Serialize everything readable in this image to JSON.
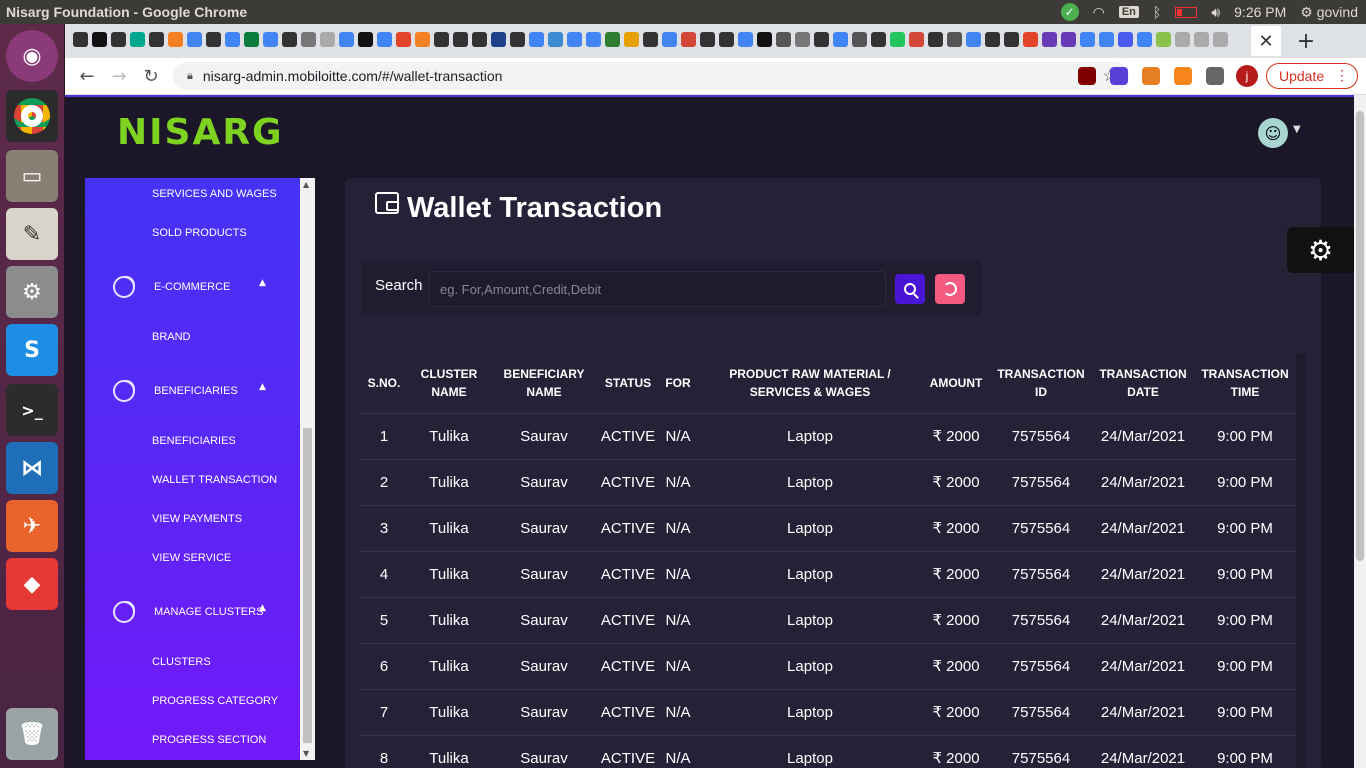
{
  "os": {
    "window_title": "Nisarg Foundation - Google Chrome",
    "lang": "En",
    "time": "9:26 PM",
    "user": "govind"
  },
  "browser": {
    "url": "nisarg-admin.mobiloitte.com/#/wallet-transaction",
    "update_label": "Update",
    "profile_initial": "j"
  },
  "header": {
    "logo": "NISARG"
  },
  "sidebar": {
    "items": [
      "SERVICES AND WAGES",
      "SOLD PRODUCTS",
      "BRAND",
      "BENEFICIARIES",
      "WALLET TRANSACTION",
      "VIEW PAYMENTS",
      "VIEW SERVICE",
      "CLUSTERS",
      "PROGRESS CATEGORY",
      "PROGRESS SECTION"
    ],
    "groups": [
      "E-COMMERCE",
      "BENEFICIARIES",
      "MANAGE CLUSTERS"
    ]
  },
  "main": {
    "title": "Wallet Transaction",
    "search_label": "Search",
    "search_placeholder": "eg. For,Amount,Credit,Debit",
    "columns": [
      [
        "S.NO."
      ],
      [
        "CLUSTER",
        "NAME"
      ],
      [
        "BENEFICIARY",
        "NAME"
      ],
      [
        "STATUS"
      ],
      [
        "FOR"
      ],
      [
        "PRODUCT RAW MATERIAL /",
        "SERVICES & WAGES"
      ],
      [
        "AMOUNT"
      ],
      [
        "TRANSACTION",
        "ID"
      ],
      [
        "TRANSACTION",
        "DATE"
      ],
      [
        "TRANSACTION",
        "TIME"
      ]
    ],
    "rows": [
      [
        "1",
        "Tulika",
        "Saurav",
        "ACTIVE",
        "N/A",
        "Laptop",
        "₹ 2000",
        "7575564",
        "24/Mar/2021",
        "9:00 PM"
      ],
      [
        "2",
        "Tulika",
        "Saurav",
        "ACTIVE",
        "N/A",
        "Laptop",
        "₹ 2000",
        "7575564",
        "24/Mar/2021",
        "9:00 PM"
      ],
      [
        "3",
        "Tulika",
        "Saurav",
        "ACTIVE",
        "N/A",
        "Laptop",
        "₹ 2000",
        "7575564",
        "24/Mar/2021",
        "9:00 PM"
      ],
      [
        "4",
        "Tulika",
        "Saurav",
        "ACTIVE",
        "N/A",
        "Laptop",
        "₹ 2000",
        "7575564",
        "24/Mar/2021",
        "9:00 PM"
      ],
      [
        "5",
        "Tulika",
        "Saurav",
        "ACTIVE",
        "N/A",
        "Laptop",
        "₹ 2000",
        "7575564",
        "24/Mar/2021",
        "9:00 PM"
      ],
      [
        "6",
        "Tulika",
        "Saurav",
        "ACTIVE",
        "N/A",
        "Laptop",
        "₹ 2000",
        "7575564",
        "24/Mar/2021",
        "9:00 PM"
      ],
      [
        "7",
        "Tulika",
        "Saurav",
        "ACTIVE",
        "N/A",
        "Laptop",
        "₹ 2000",
        "7575564",
        "24/Mar/2021",
        "9:00 PM"
      ],
      [
        "8",
        "Tulika",
        "Saurav",
        "ACTIVE",
        "N/A",
        "Laptop",
        "₹ 2000",
        "7575564",
        "24/Mar/2021",
        "9:00 PM"
      ]
    ]
  },
  "colors": {
    "sidebar_top": "#4433f5",
    "sidebar_bottom": "#7219f7",
    "logo": "#7ed321",
    "card_bg": "#272138",
    "search_btn": "#4a16d6",
    "reset_btn": "#f55a80"
  }
}
